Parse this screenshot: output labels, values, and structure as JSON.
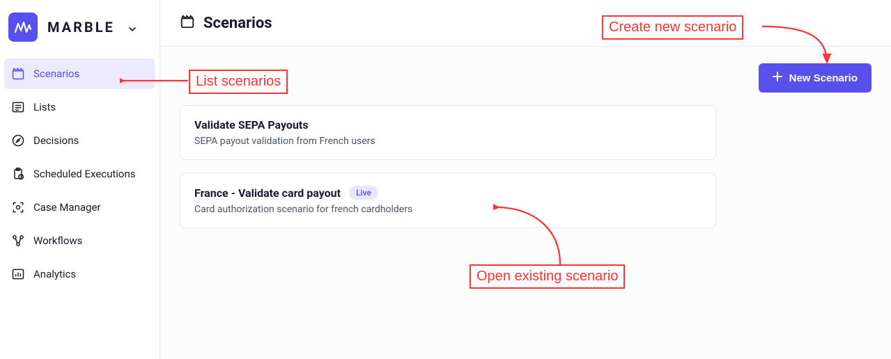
{
  "app": {
    "name": "MARBLE"
  },
  "sidebar": {
    "items": [
      {
        "label": "Scenarios",
        "icon": "clapperboard-icon"
      },
      {
        "label": "Lists",
        "icon": "list-icon"
      },
      {
        "label": "Decisions",
        "icon": "compass-icon"
      },
      {
        "label": "Scheduled Executions",
        "icon": "clipboard-icon"
      },
      {
        "label": "Case Manager",
        "icon": "scan-icon"
      },
      {
        "label": "Workflows",
        "icon": "workflow-icon"
      },
      {
        "label": "Analytics",
        "icon": "chart-icon"
      }
    ]
  },
  "header": {
    "title": "Scenarios"
  },
  "toolbar": {
    "new_scenario_label": "New Scenario"
  },
  "scenarios": [
    {
      "title": "Validate SEPA Payouts",
      "description": "SEPA payout validation from French users",
      "badge": null
    },
    {
      "title": "France - Validate card payout",
      "description": "Card authorization scenario for french cardholders",
      "badge": "Live"
    }
  ],
  "annotations": {
    "create": "Create new scenario",
    "list": "List scenarios",
    "open": "Open existing scenario"
  }
}
